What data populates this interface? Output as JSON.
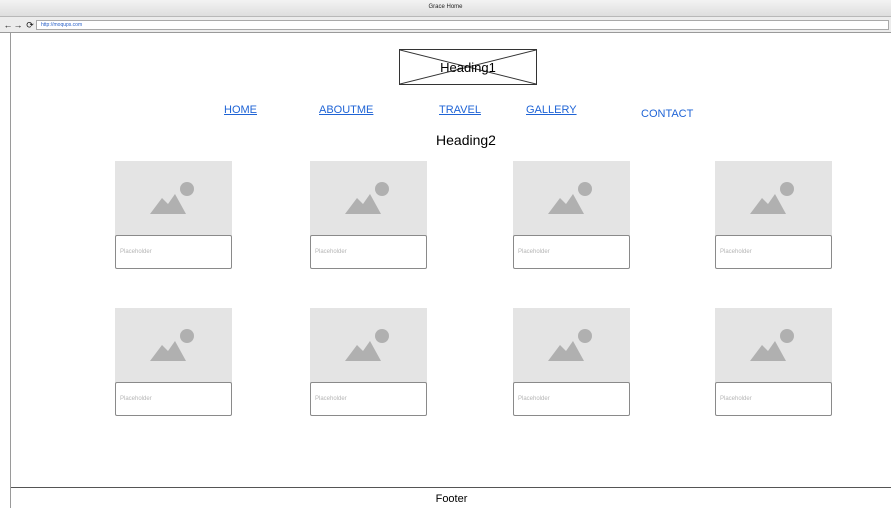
{
  "window": {
    "title": "Grace Home"
  },
  "toolbar": {
    "back_icon": "←",
    "forward_icon": "→",
    "reload_icon": "⟳",
    "url": "http://moqups.com"
  },
  "page": {
    "heading1": "Heading1",
    "nav": [
      {
        "label": "HOME"
      },
      {
        "label": "ABOUTME"
      },
      {
        "label": "TRAVEL"
      },
      {
        "label": "GALLERY"
      },
      {
        "label": "CONTACT"
      }
    ],
    "heading2": "Heading2",
    "gallery": [
      {
        "placeholder": "Placeholder"
      },
      {
        "placeholder": "Placeholder"
      },
      {
        "placeholder": "Placeholder"
      },
      {
        "placeholder": "Placeholder"
      },
      {
        "placeholder": "Placeholder"
      },
      {
        "placeholder": "Placeholder"
      },
      {
        "placeholder": "Placeholder"
      },
      {
        "placeholder": "Placeholder"
      }
    ],
    "footer": "Footer"
  },
  "colors": {
    "link": "#1f64d6",
    "image_placeholder_bg": "#e4e4e4",
    "image_icon": "#b0b0b0",
    "url_text": "#2a62c9"
  }
}
